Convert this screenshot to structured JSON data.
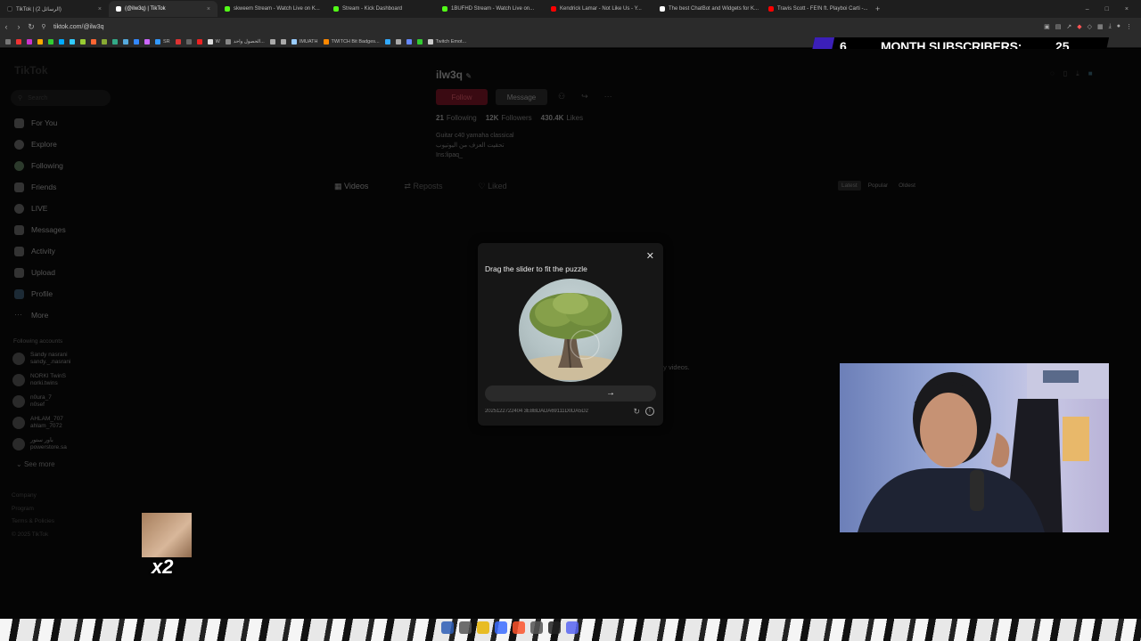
{
  "browser": {
    "tabs": [
      {
        "title": "TikTok | (الرسائل 2)",
        "color": "#111111",
        "active": false
      },
      {
        "title": "(@ilw3q) | TikTok",
        "color": "#ffffff",
        "active": true
      },
      {
        "title": "skweem Stream - Watch Live on K...",
        "color": "#53fc18",
        "active": false
      },
      {
        "title": "Stream - Kick Dashboard",
        "color": "#53fc18",
        "active": false
      },
      {
        "title": "1BUFHD Stream - Watch Live on...",
        "color": "#53fc18",
        "active": false
      },
      {
        "title": "Kendrick Lamar - Not Like Us - Y...",
        "color": "#ff0000",
        "active": false
      },
      {
        "title": "The best ChatBot and Widgets for K...",
        "color": "#ffffff",
        "active": false
      },
      {
        "title": "Travis Scott - FE!N ft. Playboi Carti -...",
        "color": "#ff0000",
        "active": false
      }
    ],
    "url": "tiktok.com/@ilw3q",
    "bookmarks": [
      "SR",
      "W",
      "الحصول واحد...",
      "IMUATH",
      "TWITCH Bit Badges...",
      "Twitch Emot..."
    ]
  },
  "overlay": {
    "sub_count_left": "6",
    "sub_label": "MONTH SUBSCRIBERS:",
    "sub_count_right": "25",
    "mini_multiplier": "x2"
  },
  "sidebar": {
    "logo": "TikTok",
    "search_placeholder": "Search",
    "items": [
      "For You",
      "Explore",
      "Following",
      "Friends",
      "LIVE",
      "Messages",
      "Activity",
      "Upload",
      "Profile",
      "More"
    ],
    "following_title": "Following accounts",
    "accounts": [
      {
        "name": "Sandy nasrani",
        "handle": "sandy._.nasrani"
      },
      {
        "name": "NORKI TwinS",
        "handle": "norki.twins"
      },
      {
        "name": "n0ura_7",
        "handle": "n0sef"
      },
      {
        "name": "AHLAM_707",
        "handle": "ahlam_7072"
      },
      {
        "name": "باور ستور",
        "handle": "powerstore.sa"
      }
    ],
    "see_more": "See more",
    "footer": [
      "Company",
      "Program",
      "Terms & Policies",
      "© 2025 TikTok"
    ]
  },
  "profile": {
    "username": "ilw3q",
    "follow_label": "Follow",
    "message_label": "Message",
    "following_count": "21",
    "following_label": "Following",
    "followers_count": "12K",
    "followers_label": "Followers",
    "likes_count": "430.4K",
    "likes_label": "Likes",
    "bio": [
      "Guitar c40 yamaha classical",
      "تحقيت العزف من اليوتيوب",
      "Ins:lipaq_"
    ],
    "tabs": [
      "Videos",
      "Reposts",
      "Liked"
    ],
    "sort": [
      "Latest",
      "Popular",
      "Oldest"
    ],
    "empty_text": "ny videos."
  },
  "captcha": {
    "title": "Drag the slider to fit the puzzle",
    "code": "2025122722404 3E8BDADA69111D0DA5D2"
  }
}
